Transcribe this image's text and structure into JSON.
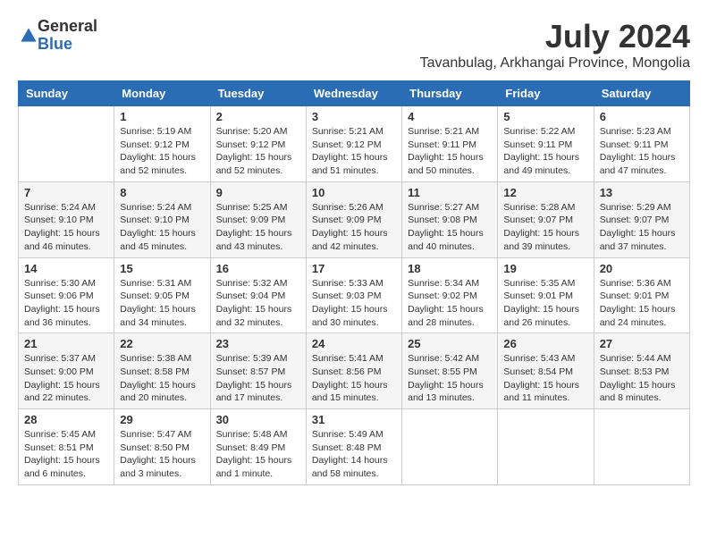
{
  "logo": {
    "general": "General",
    "blue": "Blue"
  },
  "title": "July 2024",
  "location": "Tavanbulag, Arkhangai Province, Mongolia",
  "weekdays": [
    "Sunday",
    "Monday",
    "Tuesday",
    "Wednesday",
    "Thursday",
    "Friday",
    "Saturday"
  ],
  "weeks": [
    [
      {
        "day": null
      },
      {
        "day": "1",
        "sunrise": "Sunrise: 5:19 AM",
        "sunset": "Sunset: 9:12 PM",
        "daylight": "Daylight: 15 hours and 52 minutes."
      },
      {
        "day": "2",
        "sunrise": "Sunrise: 5:20 AM",
        "sunset": "Sunset: 9:12 PM",
        "daylight": "Daylight: 15 hours and 52 minutes."
      },
      {
        "day": "3",
        "sunrise": "Sunrise: 5:21 AM",
        "sunset": "Sunset: 9:12 PM",
        "daylight": "Daylight: 15 hours and 51 minutes."
      },
      {
        "day": "4",
        "sunrise": "Sunrise: 5:21 AM",
        "sunset": "Sunset: 9:11 PM",
        "daylight": "Daylight: 15 hours and 50 minutes."
      },
      {
        "day": "5",
        "sunrise": "Sunrise: 5:22 AM",
        "sunset": "Sunset: 9:11 PM",
        "daylight": "Daylight: 15 hours and 49 minutes."
      },
      {
        "day": "6",
        "sunrise": "Sunrise: 5:23 AM",
        "sunset": "Sunset: 9:11 PM",
        "daylight": "Daylight: 15 hours and 47 minutes."
      }
    ],
    [
      {
        "day": "7",
        "sunrise": "Sunrise: 5:24 AM",
        "sunset": "Sunset: 9:10 PM",
        "daylight": "Daylight: 15 hours and 46 minutes."
      },
      {
        "day": "8",
        "sunrise": "Sunrise: 5:24 AM",
        "sunset": "Sunset: 9:10 PM",
        "daylight": "Daylight: 15 hours and 45 minutes."
      },
      {
        "day": "9",
        "sunrise": "Sunrise: 5:25 AM",
        "sunset": "Sunset: 9:09 PM",
        "daylight": "Daylight: 15 hours and 43 minutes."
      },
      {
        "day": "10",
        "sunrise": "Sunrise: 5:26 AM",
        "sunset": "Sunset: 9:09 PM",
        "daylight": "Daylight: 15 hours and 42 minutes."
      },
      {
        "day": "11",
        "sunrise": "Sunrise: 5:27 AM",
        "sunset": "Sunset: 9:08 PM",
        "daylight": "Daylight: 15 hours and 40 minutes."
      },
      {
        "day": "12",
        "sunrise": "Sunrise: 5:28 AM",
        "sunset": "Sunset: 9:07 PM",
        "daylight": "Daylight: 15 hours and 39 minutes."
      },
      {
        "day": "13",
        "sunrise": "Sunrise: 5:29 AM",
        "sunset": "Sunset: 9:07 PM",
        "daylight": "Daylight: 15 hours and 37 minutes."
      }
    ],
    [
      {
        "day": "14",
        "sunrise": "Sunrise: 5:30 AM",
        "sunset": "Sunset: 9:06 PM",
        "daylight": "Daylight: 15 hours and 36 minutes."
      },
      {
        "day": "15",
        "sunrise": "Sunrise: 5:31 AM",
        "sunset": "Sunset: 9:05 PM",
        "daylight": "Daylight: 15 hours and 34 minutes."
      },
      {
        "day": "16",
        "sunrise": "Sunrise: 5:32 AM",
        "sunset": "Sunset: 9:04 PM",
        "daylight": "Daylight: 15 hours and 32 minutes."
      },
      {
        "day": "17",
        "sunrise": "Sunrise: 5:33 AM",
        "sunset": "Sunset: 9:03 PM",
        "daylight": "Daylight: 15 hours and 30 minutes."
      },
      {
        "day": "18",
        "sunrise": "Sunrise: 5:34 AM",
        "sunset": "Sunset: 9:02 PM",
        "daylight": "Daylight: 15 hours and 28 minutes."
      },
      {
        "day": "19",
        "sunrise": "Sunrise: 5:35 AM",
        "sunset": "Sunset: 9:01 PM",
        "daylight": "Daylight: 15 hours and 26 minutes."
      },
      {
        "day": "20",
        "sunrise": "Sunrise: 5:36 AM",
        "sunset": "Sunset: 9:01 PM",
        "daylight": "Daylight: 15 hours and 24 minutes."
      }
    ],
    [
      {
        "day": "21",
        "sunrise": "Sunrise: 5:37 AM",
        "sunset": "Sunset: 9:00 PM",
        "daylight": "Daylight: 15 hours and 22 minutes."
      },
      {
        "day": "22",
        "sunrise": "Sunrise: 5:38 AM",
        "sunset": "Sunset: 8:58 PM",
        "daylight": "Daylight: 15 hours and 20 minutes."
      },
      {
        "day": "23",
        "sunrise": "Sunrise: 5:39 AM",
        "sunset": "Sunset: 8:57 PM",
        "daylight": "Daylight: 15 hours and 17 minutes."
      },
      {
        "day": "24",
        "sunrise": "Sunrise: 5:41 AM",
        "sunset": "Sunset: 8:56 PM",
        "daylight": "Daylight: 15 hours and 15 minutes."
      },
      {
        "day": "25",
        "sunrise": "Sunrise: 5:42 AM",
        "sunset": "Sunset: 8:55 PM",
        "daylight": "Daylight: 15 hours and 13 minutes."
      },
      {
        "day": "26",
        "sunrise": "Sunrise: 5:43 AM",
        "sunset": "Sunset: 8:54 PM",
        "daylight": "Daylight: 15 hours and 11 minutes."
      },
      {
        "day": "27",
        "sunrise": "Sunrise: 5:44 AM",
        "sunset": "Sunset: 8:53 PM",
        "daylight": "Daylight: 15 hours and 8 minutes."
      }
    ],
    [
      {
        "day": "28",
        "sunrise": "Sunrise: 5:45 AM",
        "sunset": "Sunset: 8:51 PM",
        "daylight": "Daylight: 15 hours and 6 minutes."
      },
      {
        "day": "29",
        "sunrise": "Sunrise: 5:47 AM",
        "sunset": "Sunset: 8:50 PM",
        "daylight": "Daylight: 15 hours and 3 minutes."
      },
      {
        "day": "30",
        "sunrise": "Sunrise: 5:48 AM",
        "sunset": "Sunset: 8:49 PM",
        "daylight": "Daylight: 15 hours and 1 minute."
      },
      {
        "day": "31",
        "sunrise": "Sunrise: 5:49 AM",
        "sunset": "Sunset: 8:48 PM",
        "daylight": "Daylight: 14 hours and 58 minutes."
      },
      {
        "day": null
      },
      {
        "day": null
      },
      {
        "day": null
      }
    ]
  ]
}
